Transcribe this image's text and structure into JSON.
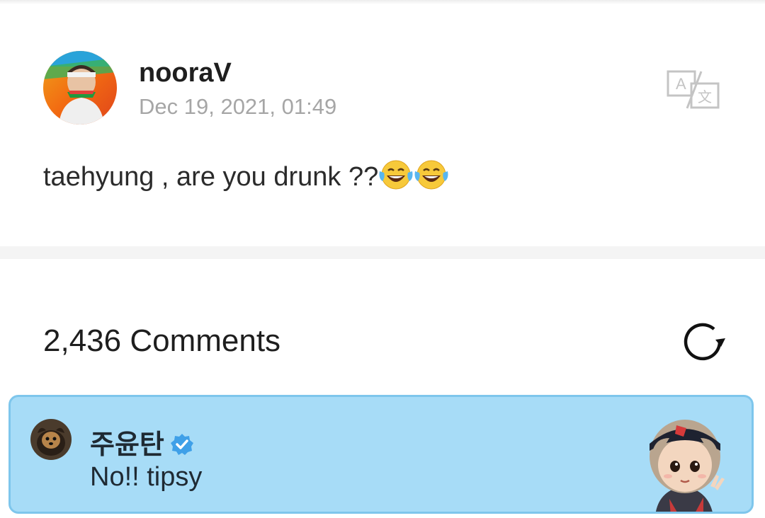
{
  "post": {
    "author": "nooraV",
    "timestamp": "Dec 19, 2021, 01:49",
    "text": "taehyung , are you drunk ??",
    "emojis": [
      "face-with-tears-of-joy",
      "face-with-tears-of-joy"
    ]
  },
  "comments_section": {
    "count_label": "2,436 Comments"
  },
  "pinned_comment": {
    "author": "주윤탄",
    "verified": true,
    "text": "No!! tipsy",
    "background": "#a7dcf7",
    "badge_color": "#3fa0e8"
  },
  "icons": {
    "translate": "translate-icon",
    "refresh": "refresh-icon"
  }
}
